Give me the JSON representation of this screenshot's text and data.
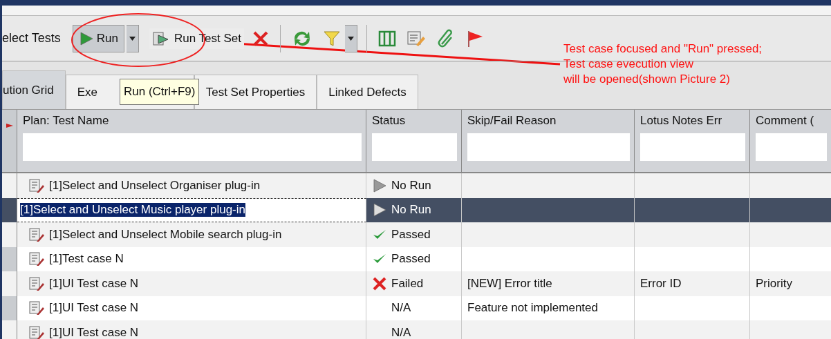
{
  "toolbar": {
    "items": [
      {
        "kind": "text",
        "label": "elect Tests"
      },
      {
        "kind": "run",
        "label": "Run",
        "pressed": true
      },
      {
        "kind": "caret"
      },
      {
        "kind": "runset",
        "label": "Run Test Set"
      },
      {
        "kind": "delete"
      },
      {
        "kind": "sep"
      },
      {
        "kind": "refresh"
      },
      {
        "kind": "filter"
      },
      {
        "kind": "caret"
      },
      {
        "kind": "sep"
      },
      {
        "kind": "columns"
      },
      {
        "kind": "edit"
      },
      {
        "kind": "clip"
      },
      {
        "kind": "flag"
      }
    ]
  },
  "tabs": [
    {
      "label": "ution Grid",
      "selected": true
    },
    {
      "label": "Exe",
      "selected": false
    },
    {
      "label": "Test Set Properties",
      "selected": false
    },
    {
      "label": "Linked Defects",
      "selected": false
    }
  ],
  "tooltip": "Run (Ctrl+F9)",
  "annotation": {
    "lines": [
      "Test case focused and \"Run\" pressed;",
      "Test case evecution view",
      "will be opened(shown Picture 2)"
    ]
  },
  "table": {
    "columns": [
      "Plan: Test Name",
      "Status",
      "Skip/Fail Reason",
      "Lotus Notes Err",
      "Comment ("
    ],
    "rows": [
      {
        "name": "[1]Select and Unselect Organiser plug-in",
        "status": {
          "kind": "norun",
          "text": "No Run"
        },
        "reason": "",
        "lotus": "",
        "comment": "",
        "selected": false
      },
      {
        "name": "[1]Select and Unselect Music player plug-in",
        "status": {
          "kind": "norun",
          "text": "No Run"
        },
        "reason": "",
        "lotus": "",
        "comment": "",
        "selected": true
      },
      {
        "name": "[1]Select and Unselect Mobile search plug-in",
        "status": {
          "kind": "passed",
          "text": "Passed"
        },
        "reason": "",
        "lotus": "",
        "comment": "",
        "selected": false
      },
      {
        "name": "[1]Test case N",
        "status": {
          "kind": "passed",
          "text": "Passed"
        },
        "reason": "",
        "lotus": "",
        "comment": "",
        "selected": false
      },
      {
        "name": "[1]UI Test case N",
        "status": {
          "kind": "failed",
          "text": "Failed"
        },
        "reason": "[NEW] Error title",
        "lotus": "Error ID",
        "comment": "Priority",
        "selected": false
      },
      {
        "name": "[1]UI Test case N",
        "status": {
          "kind": "na",
          "text": "N/A"
        },
        "reason": "Feature not implemented",
        "lotus": "",
        "comment": "",
        "selected": false
      },
      {
        "name": "[1]UI Test case N",
        "status": {
          "kind": "na",
          "text": "N/A"
        },
        "reason": "",
        "lotus": "",
        "comment": "",
        "selected": false
      }
    ]
  }
}
